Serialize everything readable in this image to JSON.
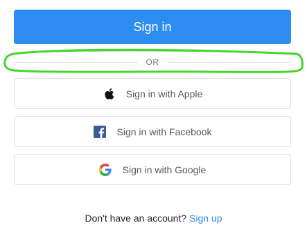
{
  "primary": {
    "signin_label": "Sign in"
  },
  "divider": {
    "text": "OR",
    "highlight_color": "#44d62c"
  },
  "providers": [
    {
      "label": "Sign in with Apple",
      "icon": "apple-icon"
    },
    {
      "label": "Sign in with Facebook",
      "icon": "facebook-icon"
    },
    {
      "label": "Sign in with Google",
      "icon": "google-icon"
    }
  ],
  "footer": {
    "prompt": "Don't have an account?",
    "link": "Sign up"
  },
  "colors": {
    "accent": "#2d8cf0",
    "facebook": "#3b5998"
  }
}
